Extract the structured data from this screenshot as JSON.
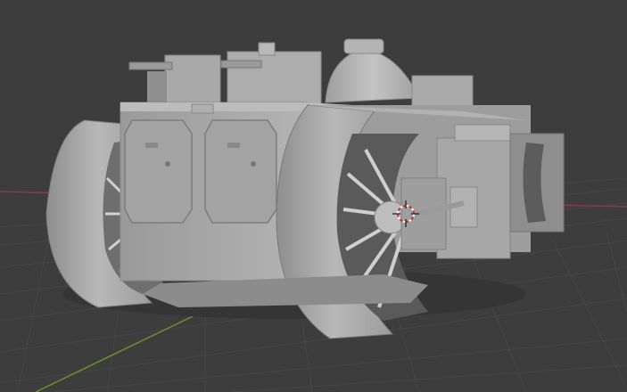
{
  "viewport": {
    "mode": "Solid",
    "object": "tank-model",
    "background_color": "#3d3d3d",
    "grid_color": "#474747",
    "x_axis_color": "#8c3a44",
    "y_axis_color": "#6f8f2a",
    "model_color": "#a8a8a8",
    "cursor_icon": "3d-cursor-icon"
  }
}
